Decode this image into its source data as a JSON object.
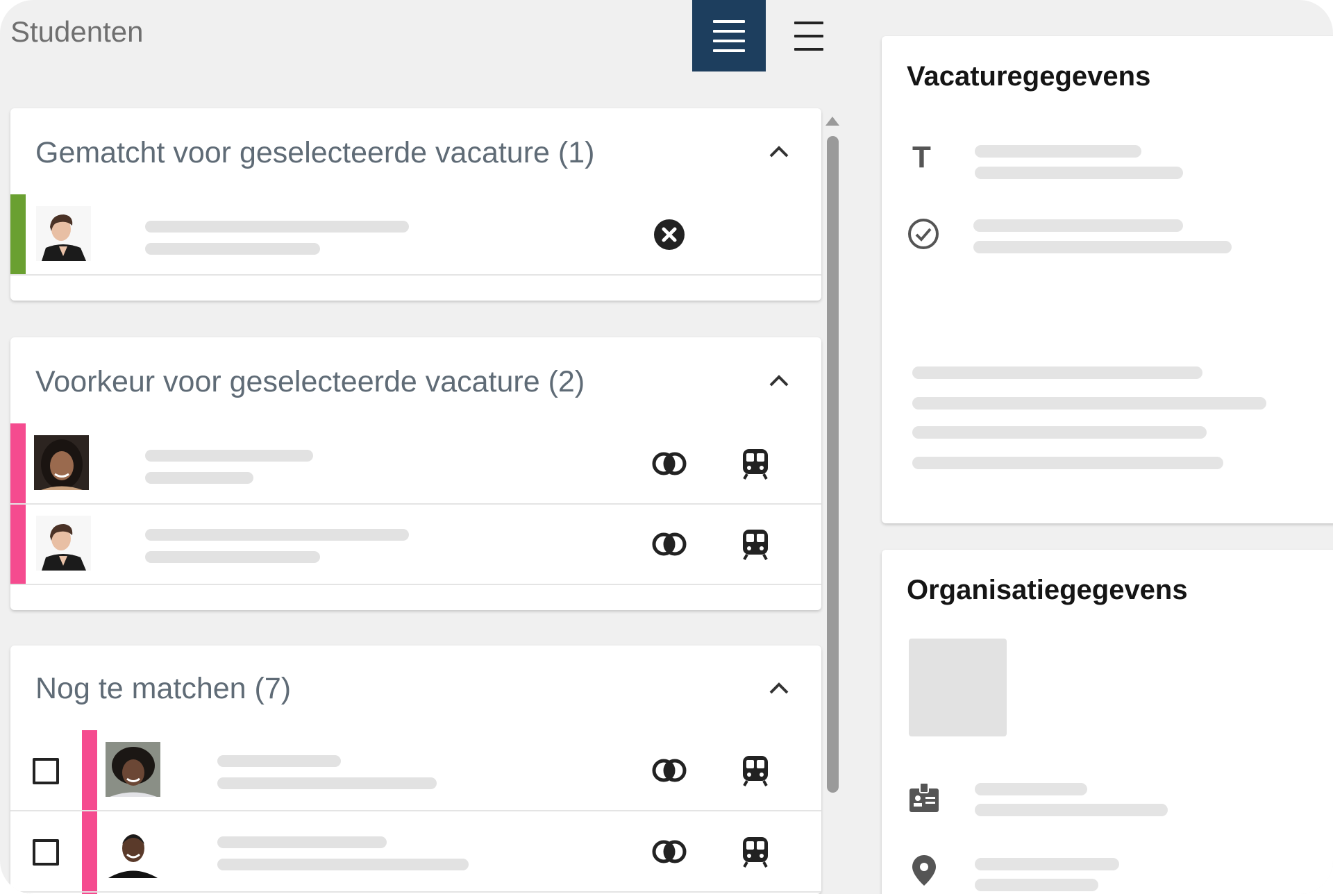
{
  "header": {
    "title": "Studenten",
    "view_active_icon": "list-view-icon",
    "view_inactive_icon": "compact-list-icon",
    "accent_color": "#1d3e5e"
  },
  "sections": [
    {
      "title": "Gematcht voor geselecteerde vacature (1)",
      "status_color": "#6aa031",
      "rows": [
        {
          "avatar": "woman-short-hair",
          "actions": [
            "unmatch-icon"
          ]
        }
      ]
    },
    {
      "title": "Voorkeur voor geselecteerde vacature (2)",
      "status_color": "#f54b8f",
      "rows": [
        {
          "avatar": "woman-curly-hair",
          "actions": [
            "match-icon",
            "train-icon"
          ]
        },
        {
          "avatar": "woman-short-hair",
          "actions": [
            "match-icon",
            "train-icon"
          ]
        }
      ]
    },
    {
      "title": "Nog te matchen (7)",
      "status_color": "#f54b8f",
      "rows": [
        {
          "avatar": "woman-afro",
          "checked": false,
          "actions": [
            "match-icon",
            "train-icon"
          ]
        },
        {
          "avatar": "man-smiling",
          "checked": false,
          "actions": [
            "match-icon",
            "train-icon"
          ]
        }
      ]
    }
  ],
  "vacancy_panel": {
    "title": "Vacaturegegevens",
    "icons": [
      "text-icon",
      "check-circle-icon"
    ]
  },
  "organisation_panel": {
    "title": "Organisatiegegevens",
    "icons": [
      "id-badge-icon",
      "location-pin-icon"
    ]
  }
}
